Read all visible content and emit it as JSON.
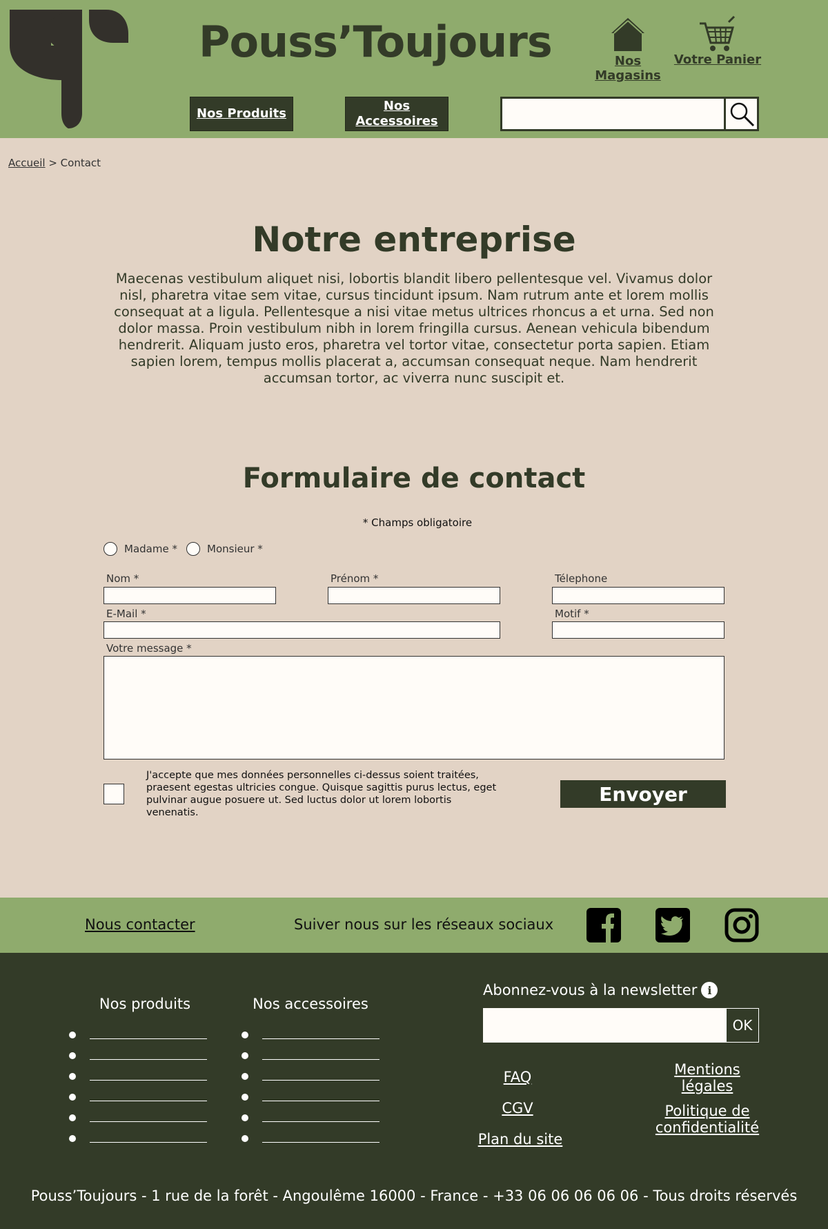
{
  "header": {
    "brand": "Pouss’Toujours",
    "stores_label_line1": "Nos",
    "stores_label_line2": "Magasins",
    "cart_label": "Votre Panier",
    "nav_products": "Nos Produits",
    "nav_accessories_line1": "Nos",
    "nav_accessories_line2": "Accessoires",
    "search_placeholder": ""
  },
  "breadcrumb": {
    "home": "Accueil",
    "separator": " > ",
    "current": "Contact"
  },
  "company": {
    "title": "Notre entreprise",
    "text": "Maecenas vestibulum aliquet nisi, lobortis blandit libero pellentesque vel. Vivamus dolor nisl, pharetra vitae sem vitae, cursus tincidunt ipsum. Nam rutrum ante et lorem mollis consequat at a ligula. Pellentesque a nisi vitae metus ultrices rhoncus a et urna. Sed non dolor massa. Proin vestibulum nibh in lorem fringilla cursus. Aenean vehicula bibendum hendrerit. Aliquam justo eros, pharetra vel tortor vitae, consectetur porta sapien. Etiam sapien lorem, tempus mollis placerat a, accumsan consequat neque. Nam hendrerit accumsan tortor, ac viverra nunc suscipit et."
  },
  "form": {
    "title": "Formulaire de contact",
    "required_note": "* Champs obligatoire",
    "radio_madame": "Madame *",
    "radio_monsieur": "Monsieur *",
    "label_nom": "Nom *",
    "label_prenom": "Prénom *",
    "label_telephone": "Télephone",
    "label_email": "E-Mail *",
    "label_motif": "Motif *",
    "label_message": "Votre message *",
    "consent": "J'accepte que mes données personnelles ci-dessus soient traitées, praesent egestas ultricies congue. Quisque sagittis purus lectus, eget pulvinar augue posuere ut. Sed luctus dolor ut lorem lobortis venenatis.",
    "submit": "Envoyer"
  },
  "social": {
    "contact": "Nous contacter",
    "follow": "Suiver nous sur les réseaux sociaux",
    "icons": [
      "facebook-icon",
      "twitter-icon",
      "instagram-icon"
    ]
  },
  "footer": {
    "products_title": "Nos produits",
    "accessories_title": "Nos accessoires",
    "newsletter_label": "Abonnez-vous à la newsletter",
    "info_glyph": "i",
    "ok": "OK",
    "faq": "FAQ",
    "cgv": "CGV",
    "sitemap": "Plan du site",
    "legal_line1": "Mentions",
    "legal_line2": "légales",
    "privacy_line1": "Politique de",
    "privacy_line2": "confidentialité",
    "copyright": "Pouss’Toujours - 1 rue de la forêt - Angoulême 16000 - France - +33 06 06 06 06 06 - Tous droits réservés"
  },
  "colors": {
    "green_light": "#8fab6d",
    "green_dark": "#333b28",
    "beige": "#e2d3c5",
    "input_bg": "#fffcf8"
  }
}
